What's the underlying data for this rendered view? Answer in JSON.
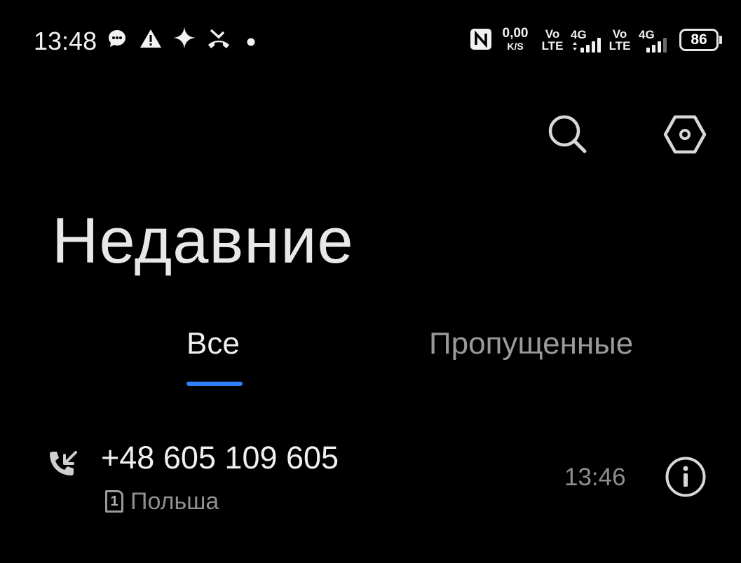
{
  "status_bar": {
    "time": "13:48",
    "notification_icons": [
      "chat-bubble-icon",
      "warning-icon",
      "sparkle-icon",
      "missed-call-icon",
      "dot-icon"
    ],
    "system_icons": [
      "nfc-icon",
      "network-speed",
      "volte-1",
      "signal-4g-1",
      "volte-2",
      "signal-4g-2",
      "battery-icon"
    ],
    "net_speed_value": "0,00",
    "net_speed_unit": "K/S",
    "volte_top": "Vo",
    "volte_bottom": "LTE",
    "network_type": "4G",
    "battery_level": "86"
  },
  "toolbar": {
    "actions": [
      "search-icon",
      "settings-icon"
    ]
  },
  "page": {
    "title": "Недавние"
  },
  "tabs": {
    "active_index": 0,
    "items": [
      {
        "label": "Все"
      },
      {
        "label": "Пропущенные"
      }
    ]
  },
  "calls": [
    {
      "direction": "incoming",
      "number": "+48 605 109 605",
      "sim": "1",
      "location": "Польша",
      "time": "13:46"
    }
  ],
  "colors": {
    "background": "#000000",
    "accent": "#2f80ff",
    "text_primary": "#f0f0f0",
    "text_secondary": "#8f8f8f"
  }
}
